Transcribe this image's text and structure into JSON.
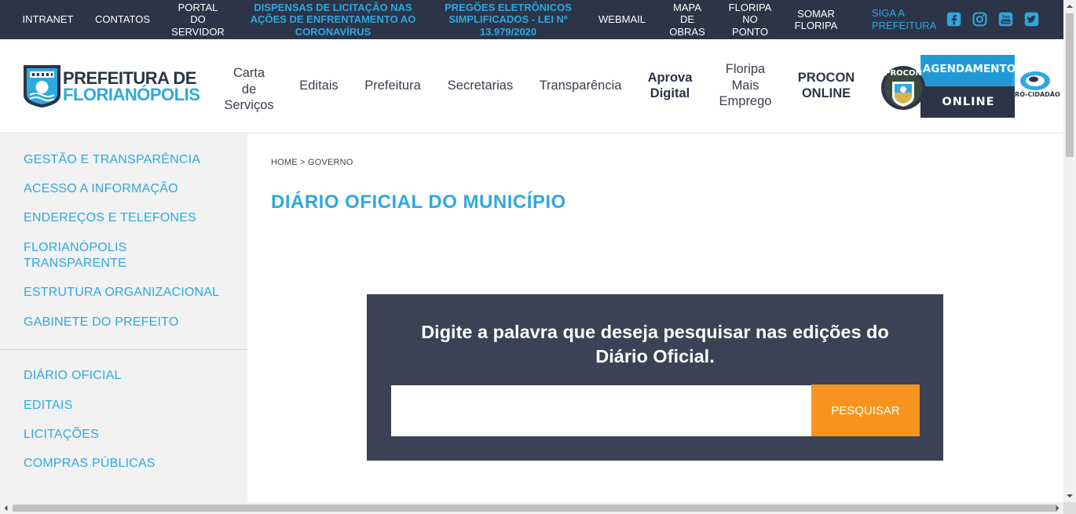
{
  "topbar": {
    "links": [
      {
        "lines": [
          "INTRANET"
        ],
        "highlight": false
      },
      {
        "lines": [
          "CONTATOS"
        ],
        "highlight": false
      },
      {
        "lines": [
          "PORTAL",
          "DO",
          "SERVIDOR"
        ],
        "highlight": false
      },
      {
        "lines": [
          "DISPENSAS DE LICITAÇÃO NAS",
          "AÇÕES DE ENFRENTAMENTO AO",
          "CORONAVÍRUS"
        ],
        "highlight": true
      },
      {
        "lines": [
          "PREGÕES ELETRÔNICOS",
          "SIMPLIFICADOS - LEI Nº",
          "13.979/2020"
        ],
        "highlight": true
      },
      {
        "lines": [
          "WEBMAIL"
        ],
        "highlight": false
      },
      {
        "lines": [
          "MAPA",
          "DE",
          "OBRAS"
        ],
        "highlight": false
      },
      {
        "lines": [
          "FLORIPA",
          "NO",
          "PONTO"
        ],
        "highlight": false
      },
      {
        "lines": [
          "SOMAR",
          "FLORIPA"
        ],
        "highlight": false
      }
    ],
    "siga": [
      "SIGA A",
      "PREFEITURA"
    ],
    "social_icons": [
      "facebook-icon",
      "instagram-icon",
      "youtube-icon",
      "twitter-icon"
    ],
    "accent_color": "#2ea8e0",
    "bg_color": "#2c3447"
  },
  "logo": {
    "line1": "PREFEITURA DE",
    "line2": "FLORIANÓPOLIS"
  },
  "nav": [
    {
      "lines": [
        "Carta",
        "de",
        "Serviços"
      ],
      "bold": false
    },
    {
      "lines": [
        "Editais"
      ],
      "bold": false
    },
    {
      "lines": [
        "Prefeitura"
      ],
      "bold": false
    },
    {
      "lines": [
        "Secretarias"
      ],
      "bold": false
    },
    {
      "lines": [
        "Transparência"
      ],
      "bold": false
    },
    {
      "lines": [
        "Aprova",
        "Digital"
      ],
      "bold": true
    },
    {
      "lines": [
        "Floripa",
        "Mais",
        "Emprego"
      ],
      "bold": false
    },
    {
      "lines": [
        "PROCON",
        "ONLINE"
      ],
      "bold": true
    }
  ],
  "procon_banner": {
    "seal": "PROCON",
    "top": "AGENDAMENTO",
    "bottom": "ONLINE",
    "brand": "PRÓ-CIDADÃO"
  },
  "sidebar": {
    "group1": [
      [
        "GESTÃO E TRANSPARÊNCIA"
      ],
      [
        "ACESSO A INFORMAÇÃO"
      ],
      [
        "ENDEREÇOS E TELEFONES"
      ],
      [
        "FLORIANÓPOLIS",
        "TRANSPARENTE"
      ],
      [
        "ESTRUTURA ORGANIZACIONAL"
      ],
      [
        "GABINETE DO PREFEITO"
      ]
    ],
    "group2": [
      [
        "DIÁRIO OFICIAL"
      ],
      [
        "EDITAIS"
      ],
      [
        "LICITAÇÕES"
      ],
      [
        "COMPRAS PÚBLICAS"
      ]
    ]
  },
  "breadcrumb": "HOME > GOVERNO",
  "page_title": "DIÁRIO OFICIAL DO MUNICÍPIO",
  "search": {
    "prompt": "Digite a palavra que deseja pesquisar nas edições do Diário Oficial.",
    "value": "",
    "placeholder": "",
    "button_label": "PESQUISAR",
    "button_color": "#f7941d",
    "panel_color": "#3b4255"
  }
}
